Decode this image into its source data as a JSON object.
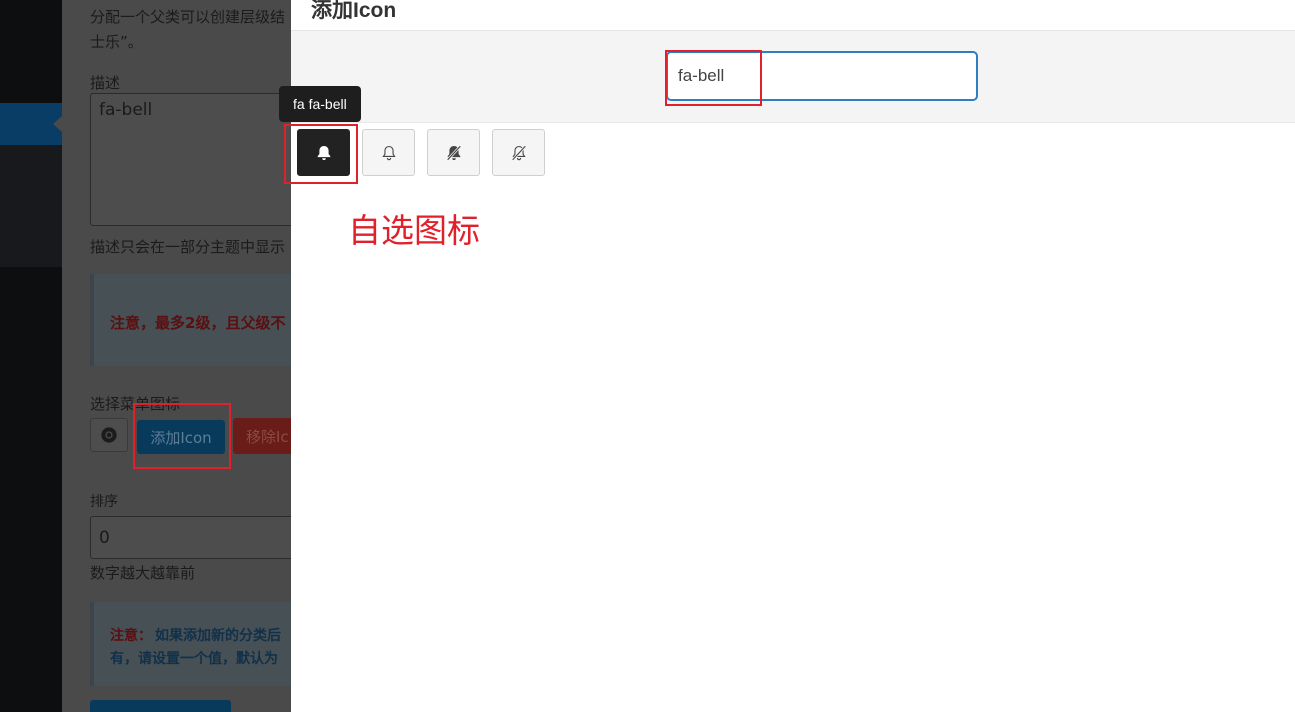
{
  "background": {
    "help_text_line1": "分配一个父类可以创建层级结",
    "help_text_line2": "士乐”。",
    "description_label": "描述",
    "description_value": "fa-bell",
    "description_help": "描述只会在一部分主题中显示",
    "notice1_text": "注意，最多2级，且父级不",
    "icon_label": "选择菜单图标",
    "add_icon_button": "添加Icon",
    "remove_icon_button": "移除Ic",
    "sort_label": "排序",
    "sort_value": "0",
    "sort_help": "数字越大越靠前",
    "notice2_prefix": "注意：",
    "notice2_line1": "如果添加新的分类后",
    "notice2_line2": "有，请设置一个值，默认为"
  },
  "modal": {
    "title": "添加Icon",
    "search": {
      "value": "fa-bell",
      "placeholder": ""
    },
    "tooltip": "fa fa-bell",
    "icons": [
      {
        "name": "bell-icon",
        "class": "fa fa-bell",
        "selected": true
      },
      {
        "name": "bell-outline-icon",
        "class": "fa fa-bell-o",
        "selected": false
      },
      {
        "name": "bell-slash-icon",
        "class": "fa fa-bell-slash",
        "selected": false
      },
      {
        "name": "bell-slash-outline-icon",
        "class": "fa fa-bell-slash-o",
        "selected": false
      }
    ]
  },
  "annotation": {
    "caption": "自选图标",
    "color": "#e0202a"
  }
}
